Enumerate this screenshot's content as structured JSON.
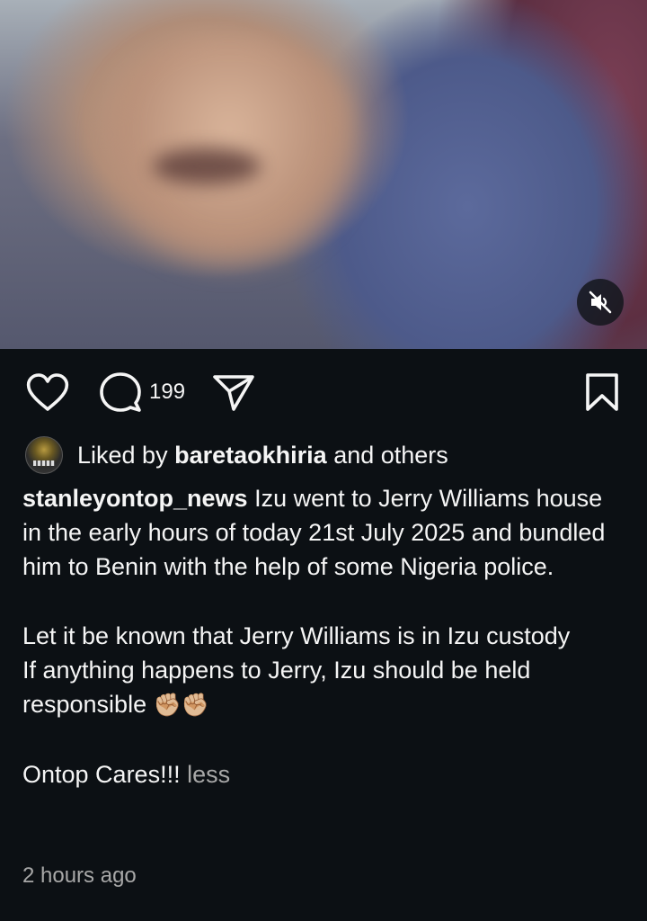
{
  "video": {
    "mute_icon": "speaker-muted-icon"
  },
  "actions": {
    "like_icon": "heart-icon",
    "comment_icon": "comment-icon",
    "comment_count": "199",
    "share_icon": "paper-plane-icon",
    "save_icon": "bookmark-icon"
  },
  "liked_by": {
    "prefix": "Liked by",
    "user": "baretaokhiria",
    "suffix": "and others"
  },
  "post": {
    "username": "stanleyontop_news",
    "line1": "Izu went to Jerry Williams house in the early hours of today 21st July 2025 and bundled him to Benin with the help of some Nigeria police.",
    "line2": "Let it be known that Jerry Williams is in Izu custody",
    "line3": "If anything happens to Jerry, Izu should be held responsible",
    "emoji": "✊🏼✊🏼",
    "line4": "Ontop Cares!!!",
    "less_label": "less",
    "timestamp": "2 hours ago"
  }
}
